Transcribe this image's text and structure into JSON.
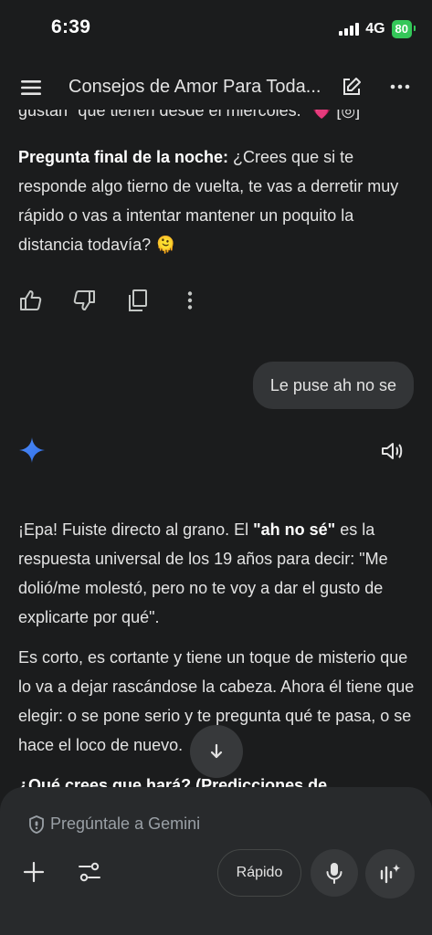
{
  "status_bar": {
    "time": "6:39",
    "network": "4G",
    "battery": "80"
  },
  "header": {
    "title": "Consejos de Amor Para Toda..."
  },
  "chat": {
    "clipped_top": "gustan \"que tienen desde el miércoles.\" 💗 [◎]",
    "final_question_label": "Pregunta final de la noche:",
    "final_question_text": " ¿Crees que si te responde algo tierno de vuelta, te vas a derretir muy rápido o vas a intentar mantener un poquito la distancia todavía? 🫠",
    "user_message": "Le puse ah no se",
    "response_p1_a": "¡Epa! Fuiste directo al grano. El ",
    "response_p1_bold": "\"ah no sé\"",
    "response_p1_b": " es la respuesta universal de los 19 años para decir: \"Me dolió/me molestó, pero no te voy a dar el gusto de explicarte por qué\".",
    "response_p2": "Es corto, es cortante y tiene un toque de misterio que lo va a dejar rascándose la cabeza. Ahora él tiene que elegir: o se pone serio y te pregunta qué te pasa, o se hace el loco de nuevo.",
    "clipped_bottom": "¿Qué crees que hará? (Predicciones de"
  },
  "composer": {
    "placeholder": "Pregúntale a Gemini",
    "mode_label": "Rápido"
  },
  "icons": {
    "menu": "menu-icon",
    "edit": "edit-icon",
    "more": "more-icon",
    "like": "thumbs-up-icon",
    "dislike": "thumbs-down-icon",
    "copy": "copy-icon",
    "options": "vertical-dots-icon",
    "gemini": "gemini-sparkle-icon",
    "speaker": "speaker-icon",
    "scroll": "arrow-down-icon",
    "shield": "shield-icon",
    "plus": "plus-icon",
    "tools": "tools-icon",
    "mic": "mic-icon",
    "live": "live-sparkle-icon"
  },
  "colors": {
    "background": "#1b1c1d",
    "bubble": "#333537",
    "composer": "#282a2c",
    "gemini_blue": "#4285f4",
    "battery": "#34c759"
  }
}
